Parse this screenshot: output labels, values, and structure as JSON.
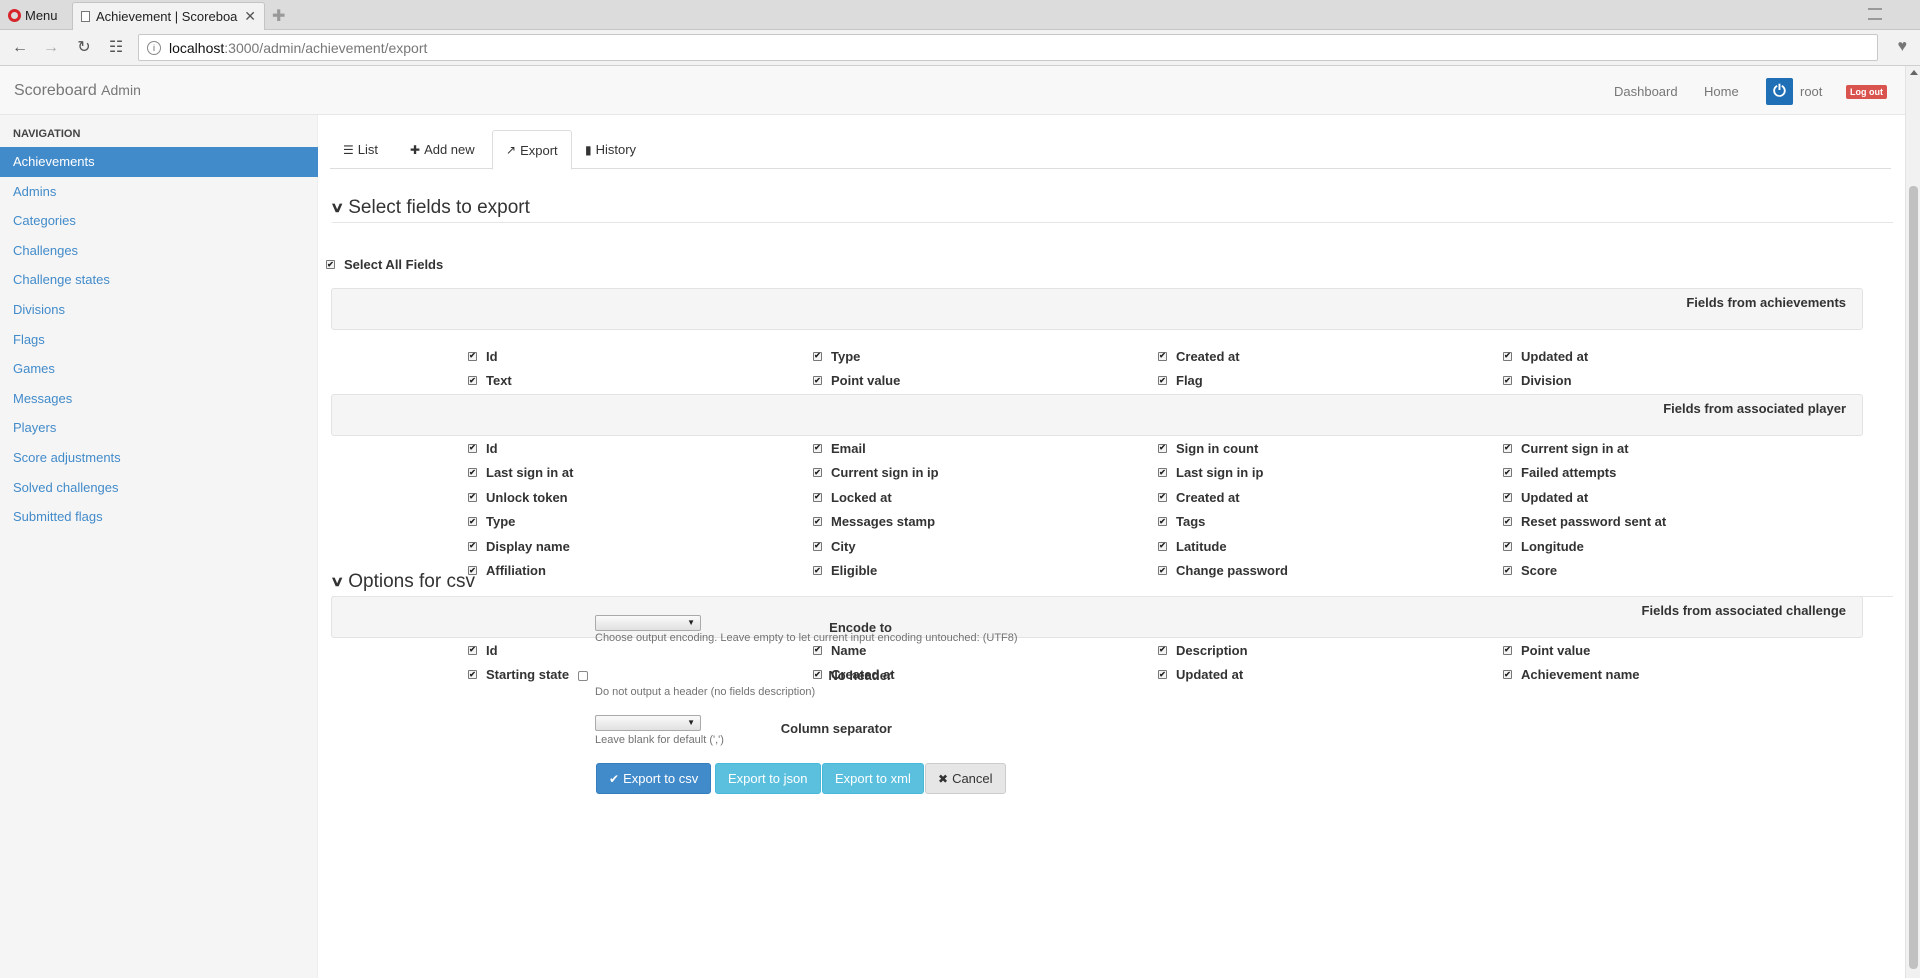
{
  "browser": {
    "menu_label": "Menu",
    "tab_title": "Achievement | Scoreboa",
    "close": "✕",
    "new_tab": "✚",
    "url_host": "localhost",
    "url_path": ":3000/admin/achievement/export"
  },
  "navbar": {
    "brand": "Scoreboard",
    "brand_sub": "Admin",
    "dashboard": "Dashboard",
    "home": "Home",
    "user": "root",
    "logout": "Log out"
  },
  "sidebar": {
    "header": "Navigation",
    "items": [
      {
        "label": "Achievements",
        "active": true
      },
      {
        "label": "Admins"
      },
      {
        "label": "Categories"
      },
      {
        "label": "Challenges"
      },
      {
        "label": "Challenge states"
      },
      {
        "label": "Divisions"
      },
      {
        "label": "Flags"
      },
      {
        "label": "Games"
      },
      {
        "label": "Messages"
      },
      {
        "label": "Players"
      },
      {
        "label": "Score adjustments"
      },
      {
        "label": "Solved challenges"
      },
      {
        "label": "Submitted flags"
      }
    ]
  },
  "tabs": {
    "list": "List",
    "add_new": "Add new",
    "export": "Export",
    "history": "History"
  },
  "fields_section": {
    "legend": "Select fields to export",
    "select_all": "Select All Fields",
    "groups": [
      {
        "title": "Fields from achievements",
        "fields": [
          "Id",
          "Type",
          "Created at",
          "Updated at",
          "Text",
          "Point value",
          "Flag",
          "Division"
        ]
      },
      {
        "title": "Fields from associated player",
        "fields": [
          "Id",
          "Email",
          "Sign in count",
          "Current sign in at",
          "Last sign in at",
          "Current sign in ip",
          "Last sign in ip",
          "Failed attempts",
          "Unlock token",
          "Locked at",
          "Created at",
          "Updated at",
          "Type",
          "Messages stamp",
          "Tags",
          "Reset password sent at",
          "Display name",
          "City",
          "Latitude",
          "Longitude",
          "Affiliation",
          "Eligible",
          "Change password",
          "Score"
        ]
      },
      {
        "title": "Fields from associated challenge",
        "fields": [
          "Id",
          "Name",
          "Description",
          "Point value",
          "Starting state",
          "Created at",
          "Updated at",
          "Achievement name"
        ]
      }
    ]
  },
  "options_section": {
    "legend": "Options for csv",
    "encode_label": "Encode to",
    "encode_value": "",
    "encode_help": "Choose output encoding. Leave empty to let current input encoding untouched: (UTF8)",
    "noheader_label": "No header",
    "noheader_help": "Do not output a header (no fields description)",
    "colsep_label": "Column separator",
    "colsep_value": "",
    "colsep_help": "Leave blank for default (',')"
  },
  "actions": {
    "csv": "Export to csv",
    "json": "Export to json",
    "xml": "Export to xml",
    "cancel": "Cancel"
  },
  "colors": {
    "primary": "#428bca",
    "info": "#5bc0de",
    "danger": "#d9534f"
  }
}
